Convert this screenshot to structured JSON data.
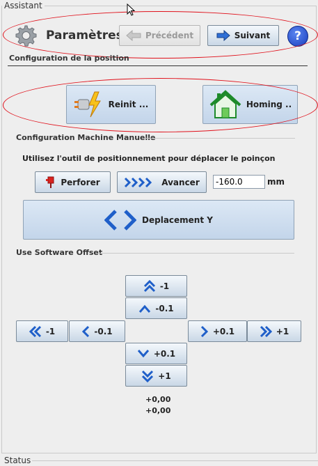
{
  "assistant": {
    "panel_title": "Assistant",
    "header_title": "Paramètres",
    "prev_label": "Précédent",
    "next_label": "Suivant",
    "help_label": "?"
  },
  "position_config": {
    "title": "Configuration de la position",
    "reinit_label": "Reinit ...",
    "homing_label": "Homing .."
  },
  "manual_config": {
    "title": "Configuration Machine Manuelle",
    "instruction": "Utilisez l'outil de positionnement pour déplacer le poinçon",
    "perforer_label": "Perforer",
    "avancer_label": "Avancer",
    "distance_value": "-160.0",
    "unit": "mm",
    "move_y_label": "Deplacement Y"
  },
  "offset": {
    "title": "Use Software Offset",
    "up_1": "-1",
    "up_01": "-0.1",
    "left_1": "-1",
    "left_01": "-0.1",
    "right_01": "+0.1",
    "right_1": "+1",
    "down_01": "+0.1",
    "down_1": "+1",
    "value_x": "+0,00",
    "value_y": "+0,00"
  },
  "status": {
    "title": "Status"
  },
  "colors": {
    "highlight": "#e0101a",
    "accent": "#1f5fc9",
    "help": "#1a3fbf"
  }
}
